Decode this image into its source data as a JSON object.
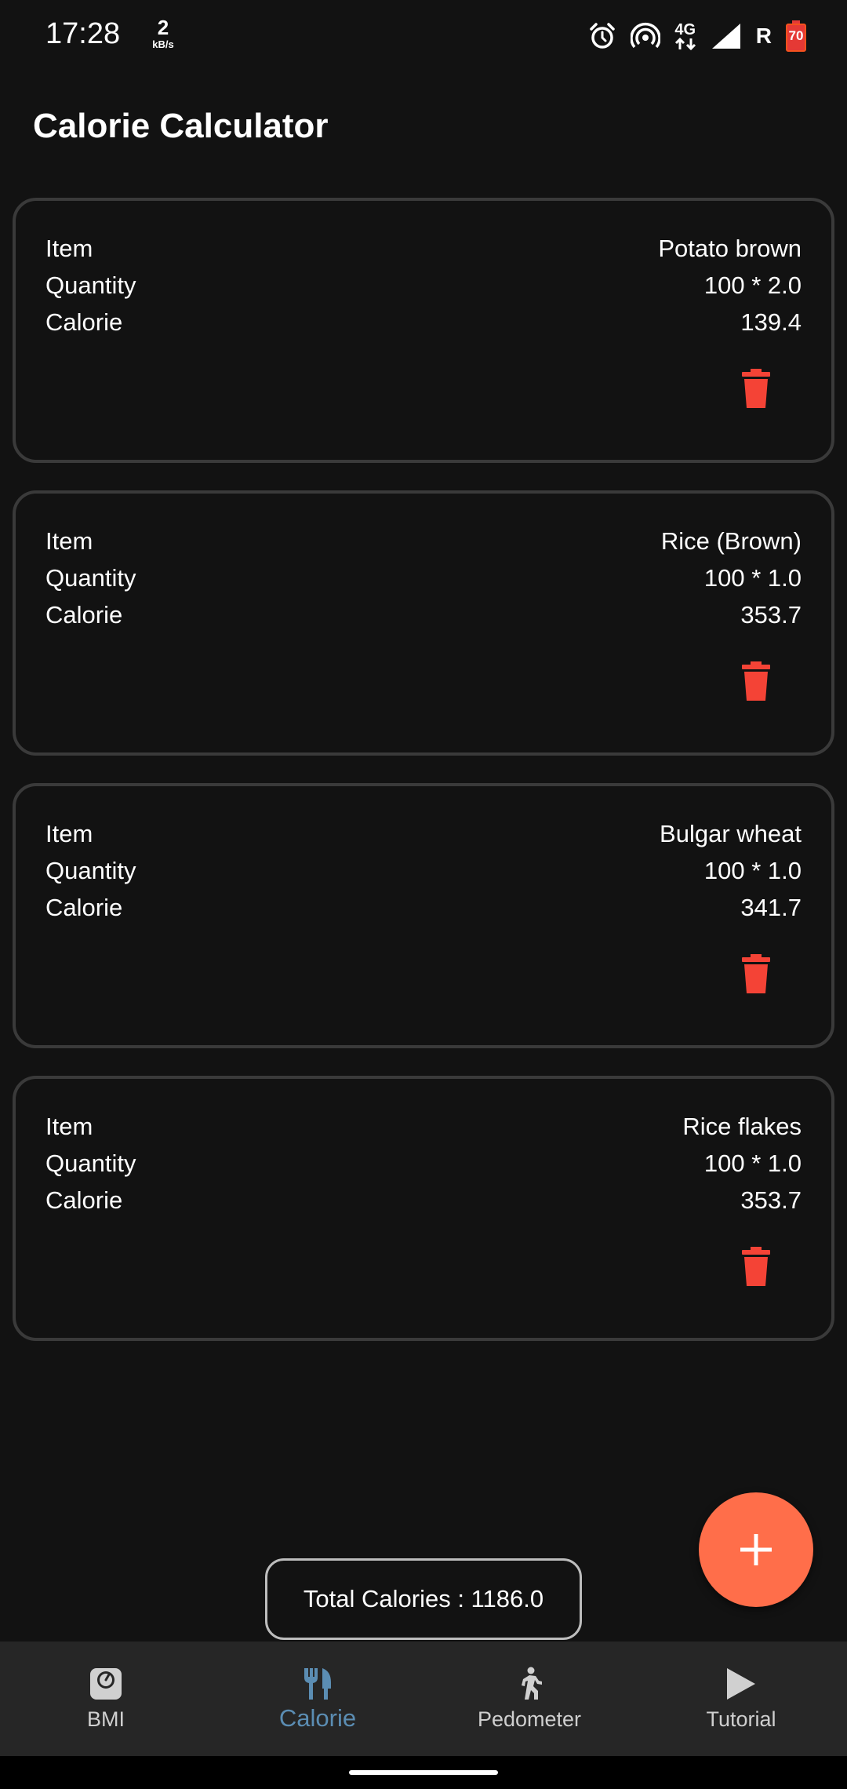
{
  "status_bar": {
    "time": "17:28",
    "net_speed_value": "2",
    "net_speed_unit": "kB/s",
    "network_type": "4G",
    "roaming": "R",
    "battery_level": "70"
  },
  "app": {
    "title": "Calorie Calculator"
  },
  "labels": {
    "item": "Item",
    "quantity": "Quantity",
    "calorie": "Calorie"
  },
  "entries": [
    {
      "item": "Potato brown",
      "quantity": "100 * 2.0",
      "calorie": "139.4"
    },
    {
      "item": "Rice (Brown)",
      "quantity": "100 * 1.0",
      "calorie": "353.7"
    },
    {
      "item": "Bulgar wheat",
      "quantity": "100 * 1.0",
      "calorie": "341.7"
    },
    {
      "item": "Rice flakes",
      "quantity": "100 * 1.0",
      "calorie": "353.7"
    }
  ],
  "total": {
    "text": "Total Calories :  1186.0"
  },
  "fab": {
    "icon": "plus-icon"
  },
  "nav": [
    {
      "label": "BMI",
      "icon": "scale-icon",
      "active": false
    },
    {
      "label": "Calorie",
      "icon": "restaurant-icon",
      "active": true
    },
    {
      "label": "Pedometer",
      "icon": "walk-icon",
      "active": false
    },
    {
      "label": "Tutorial",
      "icon": "play-icon",
      "active": false
    }
  ],
  "colors": {
    "background": "#121212",
    "accent": "#ff6e4a",
    "delete": "#f44336",
    "nav_active": "#5b8db3",
    "nav_bg": "#262626"
  }
}
